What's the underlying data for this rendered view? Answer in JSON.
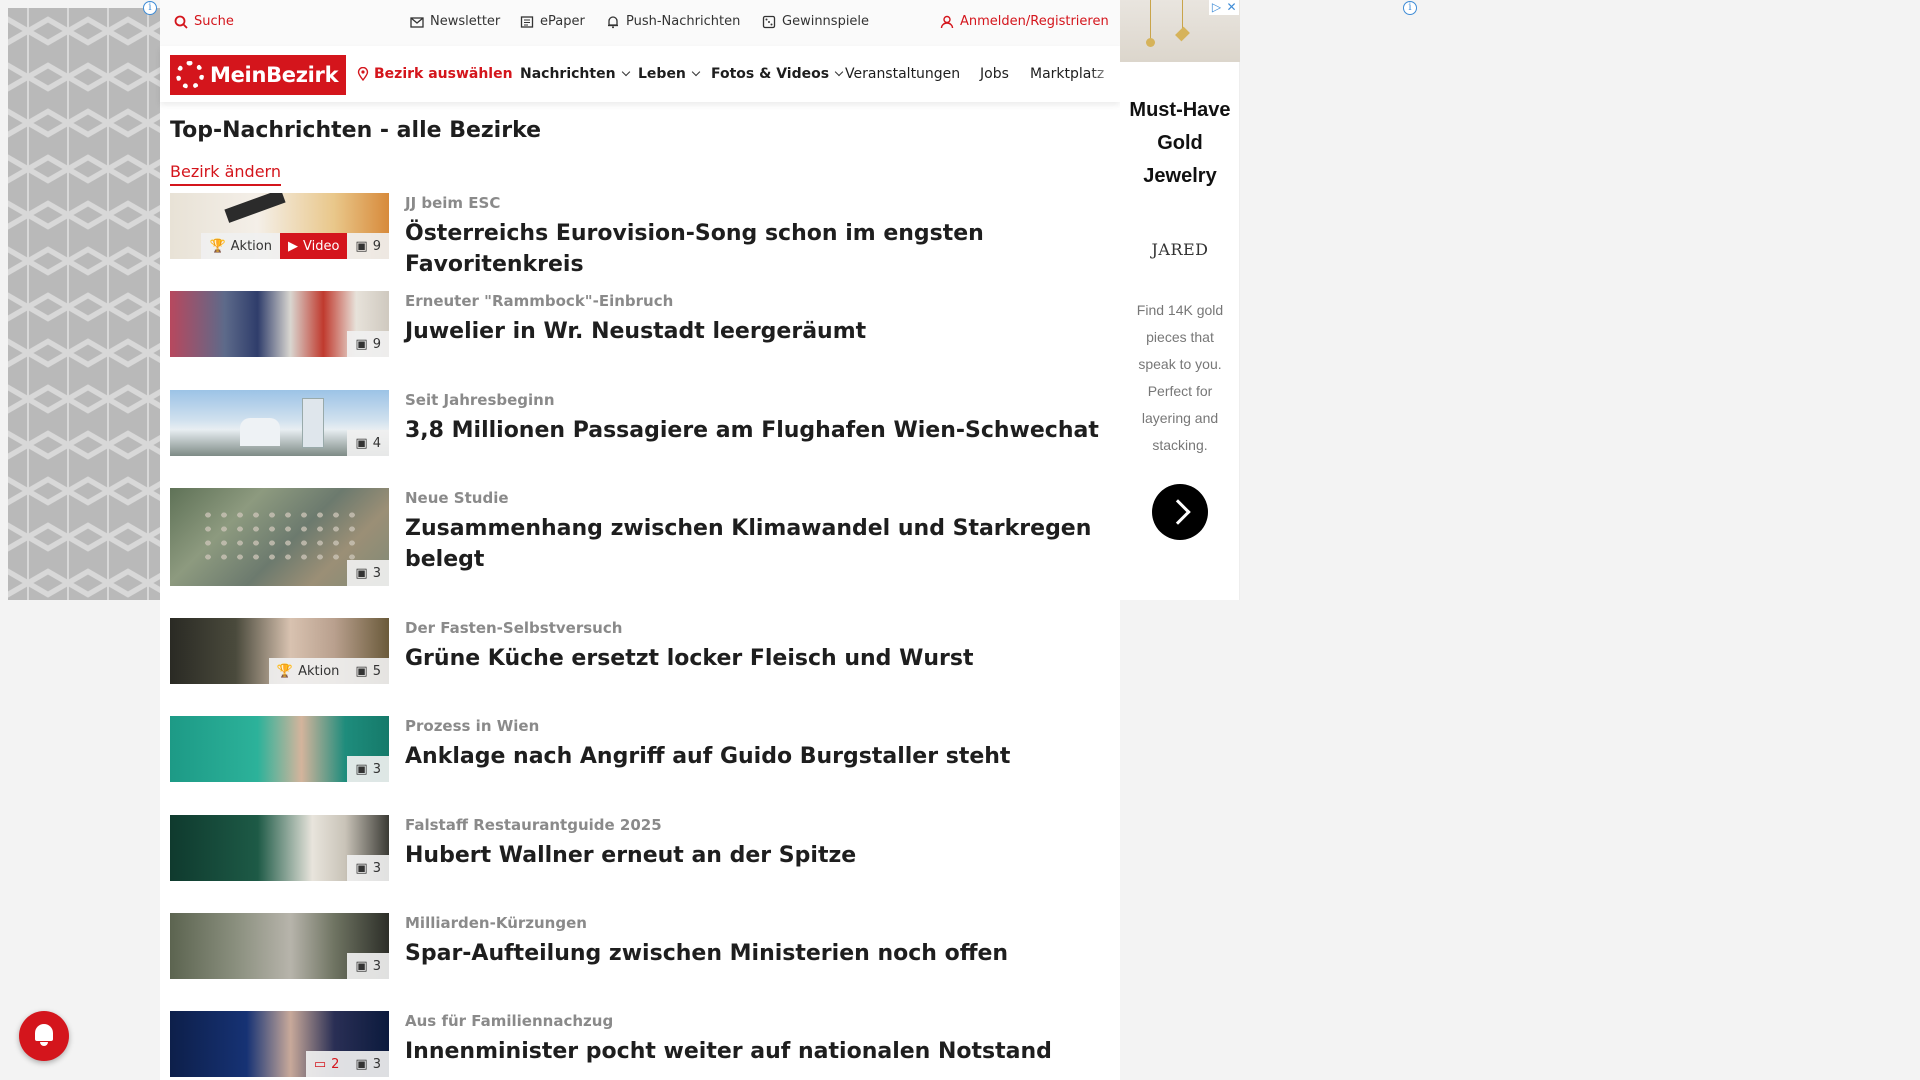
{
  "topbar": {
    "search": "Suche",
    "newsletter": "Newsletter",
    "epaper": "ePaper",
    "push": "Push-Nachrichten",
    "games": "Gewinnspiele",
    "login": "Anmelden/Registrieren"
  },
  "nav": {
    "logo": "MeinBezirk",
    "district": "Bezirk auswählen",
    "items": [
      "Nachrichten",
      "Leben",
      "Fotos & Videos",
      "Veranstaltungen",
      "Jobs",
      "Marktplatz"
    ]
  },
  "page": {
    "title": "Top-Nachrichten - alle Bezirke",
    "change_district": "Bezirk ändern"
  },
  "articles": [
    {
      "kicker": "JJ beim ESC",
      "headline": "Österreichs Eurovision-Song schon im engsten Favoritenkreis",
      "badges": {
        "aktion": "Aktion",
        "video": "Video",
        "photos": "9"
      }
    },
    {
      "kicker": "Erneuter \"Rammbock\"-Einbruch",
      "headline": "Juwelier in Wr. Neustadt leergeräumt",
      "badges": {
        "photos": "9"
      }
    },
    {
      "kicker": "Seit Jahresbeginn",
      "headline": "3,8 Millionen Passagiere am Flughafen Wien-Schwechat",
      "badges": {
        "photos": "4"
      }
    },
    {
      "kicker": "Neue Studie",
      "headline": "Zusammenhang zwischen Klimawandel und Starkregen belegt",
      "badges": {
        "photos": "3"
      }
    },
    {
      "kicker": "Der Fasten-Selbstversuch",
      "headline": "Grüne Küche ersetzt locker Fleisch und Wurst",
      "badges": {
        "aktion": "Aktion",
        "photos": "5"
      }
    },
    {
      "kicker": "Prozess in Wien",
      "headline": "Anklage nach Angriff auf Guido Burgstaller steht",
      "badges": {
        "photos": "3"
      }
    },
    {
      "kicker": "Falstaff Restaurantguide 2025",
      "headline": "Hubert Wallner erneut an der Spitze",
      "badges": {
        "photos": "3"
      }
    },
    {
      "kicker": "Milliarden-Kürzungen",
      "headline": "Spar-Aufteilung zwischen Ministerien noch offen",
      "badges": {
        "photos": "3"
      }
    },
    {
      "kicker": "Aus für Familiennachzug",
      "headline": "Innenminister pocht weiter auf nationalen Notstand",
      "badges": {
        "comments": "2",
        "photos": "3"
      }
    }
  ],
  "ad": {
    "headline": "Must-Have Gold Jewelry",
    "brand": "JARED",
    "copy": "Find 14K gold pieces that speak to you. Perfect for layering and stacking."
  },
  "colors": {
    "brand_red": "#d4151c",
    "kicker_gray": "#8a8a8a"
  }
}
